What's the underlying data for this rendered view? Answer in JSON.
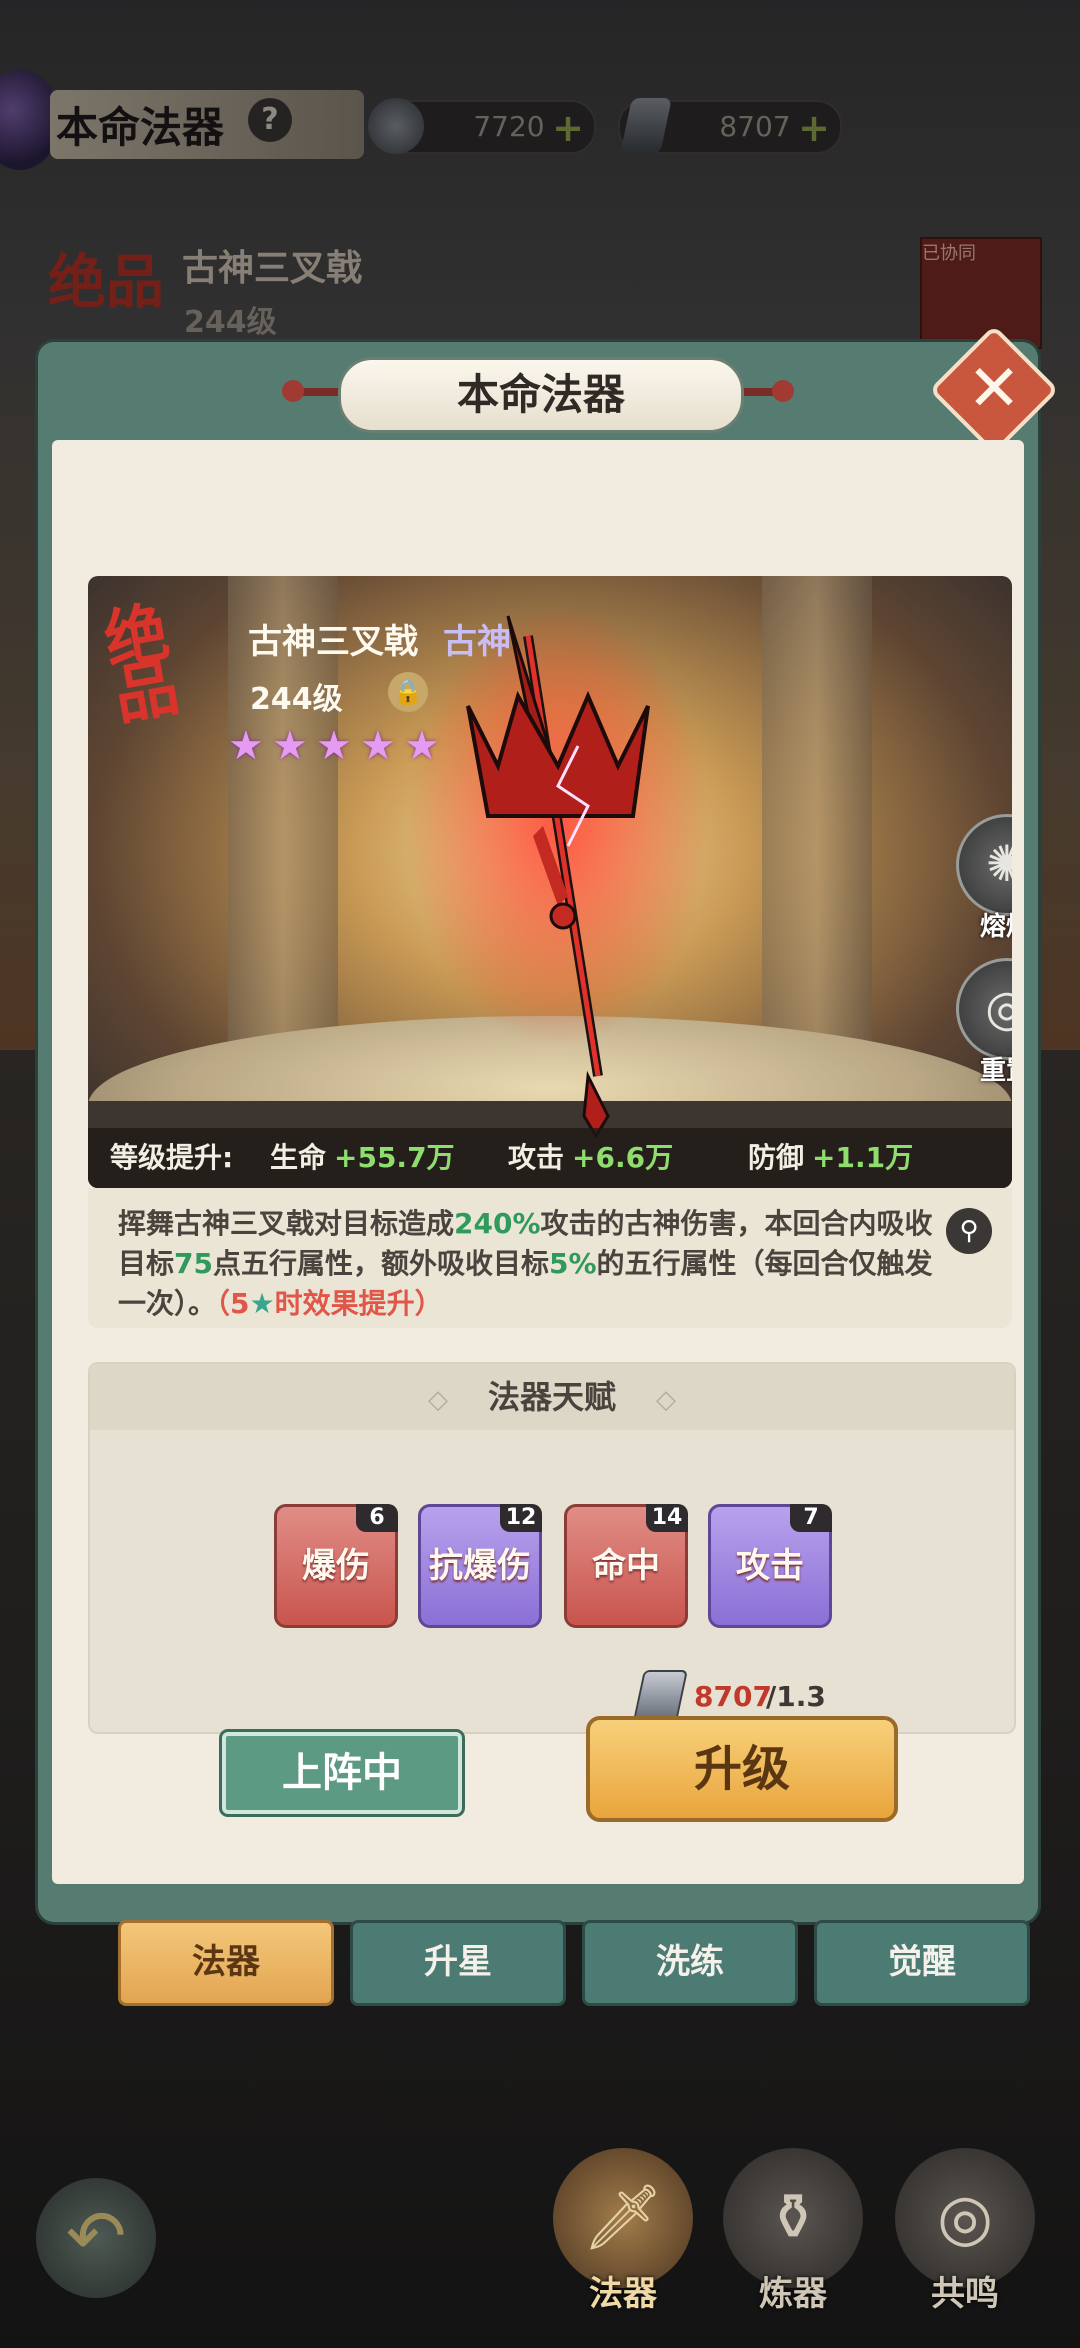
{
  "topbar": {
    "title": "本命法器",
    "help_icon": "?",
    "spirit_currency": "7720",
    "stone_currency": "8707",
    "plus": "+"
  },
  "background_weapon": {
    "rarity_badge": "绝品",
    "name": "古神三叉戟",
    "level": "244级",
    "deployed_tag": "已协同"
  },
  "modal": {
    "title": "本命法器",
    "close_icon": "✕",
    "weapon": {
      "rarity_badge": "绝品",
      "name": "古神三叉戟",
      "tier": "古神",
      "level": "244级",
      "stars": 5,
      "star_glyph": "★",
      "lock_icon": "🔒"
    },
    "side_buttons": {
      "smelt": "熔炼",
      "reset": "重置"
    },
    "level_bonus": {
      "label": "等级提升:",
      "hp_label": "生命",
      "hp_value": "+55.7万",
      "atk_label": "攻击",
      "atk_value": "+6.6万",
      "def_label": "防御",
      "def_value": "+1.1万"
    },
    "description": {
      "p1": "挥舞古神三叉戟对目标造成",
      "v1": "240%",
      "p2": "攻击的古神伤害，本回合内吸收目标",
      "v2": "75",
      "p3": "点五行属性，额外吸收目标",
      "v3": "5%",
      "p4": "的五行属性（每回合仅触发一次）。",
      "bonus_open": "（5",
      "bonus_star": "★",
      "bonus_close": "时效果提升）"
    },
    "talents": {
      "title": "法器天赋",
      "items": [
        {
          "label": "爆伤",
          "count": "6"
        },
        {
          "label": "抗爆伤",
          "count": "12"
        },
        {
          "label": "命中",
          "count": "14"
        },
        {
          "label": "攻击",
          "count": "7"
        }
      ]
    },
    "cost": {
      "have": "8707",
      "need": "/1.3万"
    },
    "deploy_button": "上阵中",
    "upgrade_button": "升级"
  },
  "tabs": [
    "法器",
    "升星",
    "洗练",
    "觉醒"
  ],
  "bottom_nav": {
    "back_icon": "↶",
    "items": [
      {
        "label": "法器",
        "icon": "🗡"
      },
      {
        "label": "炼器",
        "icon": "⚱"
      },
      {
        "label": "共鸣",
        "icon": "◎"
      }
    ]
  },
  "colors": {
    "modal_frame": "#567c72",
    "panel_bg": "#f1ecdf",
    "accent_gold": "#e9a53c",
    "stat_green": "#8fdc6f",
    "rarity_red": "#d9342b"
  }
}
